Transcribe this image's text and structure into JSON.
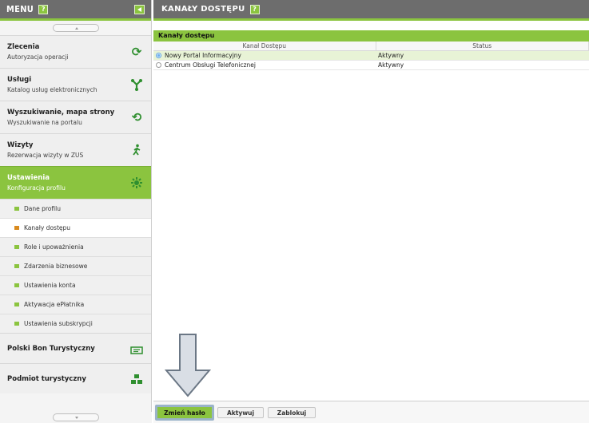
{
  "sidebar": {
    "header_title": "MENU",
    "help_label": "?",
    "items": [
      {
        "title": "Zlecenia",
        "subtitle": "Autoryzacja operacji",
        "icon": "refresh-icon"
      },
      {
        "title": "Usługi",
        "subtitle": "Katalog usług elektronicznych",
        "icon": "network-icon"
      },
      {
        "title": "Wyszukiwanie, mapa strony",
        "subtitle": "Wyszukiwanie na portalu",
        "icon": "search-refresh-icon"
      },
      {
        "title": "Wizyty",
        "subtitle": "Rezerwacja wizyty w ZUS",
        "icon": "walking-person-icon"
      },
      {
        "title": "Ustawienia",
        "subtitle": "Konfiguracja profilu",
        "icon": "gear-icon"
      }
    ],
    "sub_items": [
      "Dane profilu",
      "Kanały dostępu",
      "Role i upoważnienia",
      "Zdarzenia biznesowe",
      "Ustawienia konta",
      "Aktywacja ePłatnika",
      "Ustawienia subskrypcji"
    ],
    "bottom_items": [
      {
        "title": "Polski Bon Turystyczny",
        "icon": "voucher-icon"
      },
      {
        "title": "Podmiot turystyczny",
        "icon": "group-icon"
      }
    ]
  },
  "main": {
    "header_title": "KANAŁY DOSTĘPU",
    "help_label": "?",
    "panel_title": "Kanały dostępu",
    "columns": [
      "Kanał Dostępu",
      "Status"
    ],
    "rows": [
      {
        "channel": "Nowy Portal Informacyjny",
        "status": "Aktywny"
      },
      {
        "channel": "Centrum Obsługi Telefonicznej",
        "status": "Aktywny"
      }
    ],
    "buttons": {
      "change_password": "Zmień hasło",
      "activate": "Aktywuj",
      "block": "Zablokuj"
    }
  },
  "colors": {
    "accent": "#8bc43f",
    "header_bg": "#6d6d6d",
    "selected_bullet": "#d98a1e"
  }
}
